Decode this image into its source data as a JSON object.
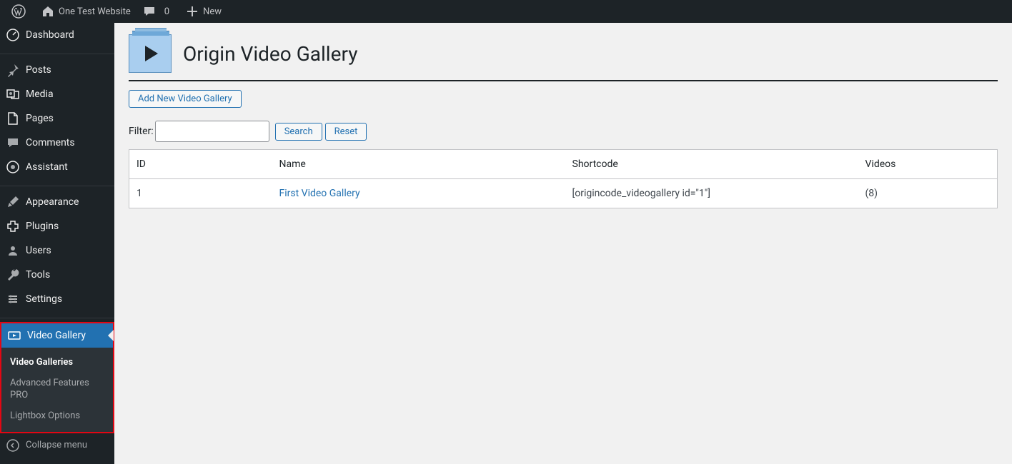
{
  "adminbar": {
    "site_name": "One Test Website",
    "comments_count": "0",
    "new_label": "New"
  },
  "sidebar": {
    "items": [
      {
        "label": "Dashboard",
        "icon": "dashboard"
      },
      {
        "label": "Posts",
        "icon": "pin"
      },
      {
        "label": "Media",
        "icon": "media"
      },
      {
        "label": "Pages",
        "icon": "page"
      },
      {
        "label": "Comments",
        "icon": "comment"
      },
      {
        "label": "Assistant",
        "icon": "assistant"
      },
      {
        "label": "Appearance",
        "icon": "brush"
      },
      {
        "label": "Plugins",
        "icon": "plugin"
      },
      {
        "label": "Users",
        "icon": "users"
      },
      {
        "label": "Tools",
        "icon": "tools"
      },
      {
        "label": "Settings",
        "icon": "settings"
      },
      {
        "label": "Video Gallery",
        "icon": "video"
      }
    ],
    "submenu": [
      {
        "label": "Video Galleries",
        "current": true
      },
      {
        "label": "Advanced Features PRO",
        "current": false
      },
      {
        "label": "Lightbox Options",
        "current": false
      }
    ],
    "collapse_label": "Collapse menu"
  },
  "page": {
    "title": "Origin Video Gallery",
    "add_button": "Add New Video Gallery",
    "filter_label": "Filter:",
    "filter_value": "",
    "search_button": "Search",
    "reset_button": "Reset"
  },
  "table": {
    "headers": {
      "id": "ID",
      "name": "Name",
      "shortcode": "Shortcode",
      "videos": "Videos"
    },
    "rows": [
      {
        "id": "1",
        "name": "First Video Gallery",
        "shortcode": "[origincode_videogallery id=\"1\"]",
        "videos": "(8)"
      }
    ]
  }
}
